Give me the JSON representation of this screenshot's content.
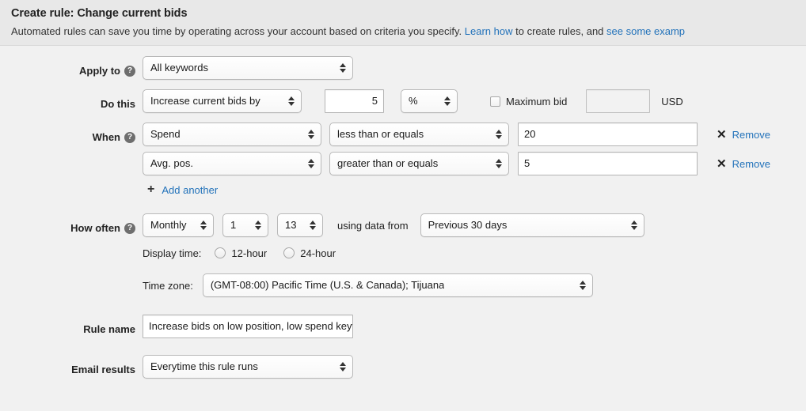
{
  "header": {
    "title": "Create rule: Change current bids",
    "desc_part1": "Automated rules can save you time by operating across your account based on criteria you specify. ",
    "link_learn": "Learn how",
    "desc_part2": " to create rules, and ",
    "link_examples": "see some examp",
    "help_icon": "question-mark-icon"
  },
  "apply_to": {
    "label": "Apply to",
    "value": "All keywords"
  },
  "do_this": {
    "label": "Do this",
    "action": "Increase current bids by",
    "amount": "5",
    "unit": "%",
    "max_bid_label": "Maximum bid",
    "max_bid_value": "",
    "currency": "USD"
  },
  "when": {
    "label": "When",
    "conditions": [
      {
        "metric": "Spend",
        "operator": "less than or equals",
        "value": "20",
        "remove": "Remove"
      },
      {
        "metric": "Avg. pos.",
        "operator": "greater than or equals",
        "value": "5",
        "remove": "Remove"
      }
    ],
    "add_another": "Add another"
  },
  "how_often": {
    "label": "How often",
    "frequency": "Monthly",
    "day": "1",
    "hour": "13",
    "using_data_from_label": "using data from",
    "date_range": "Previous 30 days",
    "display_time_label": "Display time:",
    "time_options": [
      "12-hour",
      "24-hour"
    ],
    "time_zone_label": "Time zone:",
    "time_zone": "(GMT-08:00) Pacific Time (U.S. & Canada); Tijuana"
  },
  "rule_name": {
    "label": "Rule name",
    "value": "Increase bids on low position, low spend keywords"
  },
  "email_results": {
    "label": "Email results",
    "value": "Everytime this rule runs"
  },
  "colors": {
    "link": "#2272ba",
    "header_bg": "#e8e8e8",
    "page_bg": "#f1f1f1"
  }
}
